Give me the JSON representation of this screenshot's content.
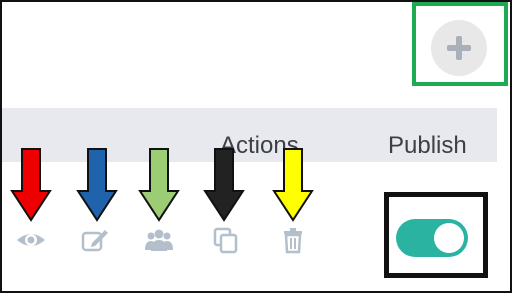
{
  "table": {
    "actions_header": "Actions",
    "publish_header": "Publish"
  },
  "row": {
    "action_icons": [
      "eye-icon",
      "edit-icon",
      "users-icon",
      "copy-icon",
      "trash-icon"
    ],
    "publish_toggle": {
      "state": "on"
    }
  },
  "annotations": {
    "arrow_colors": [
      "#ee0000",
      "#1f63ad",
      "#9ccc74",
      "#222222",
      "#ffff00"
    ],
    "add_highlight_color": "#1faa52",
    "toggle_highlight_color": "#111111"
  },
  "colors": {
    "header_bg": "#e7e9ee",
    "icon": "#b4bfcc",
    "toggle_on": "#2ab3a0",
    "add_button_bg": "#e8e8e8"
  }
}
